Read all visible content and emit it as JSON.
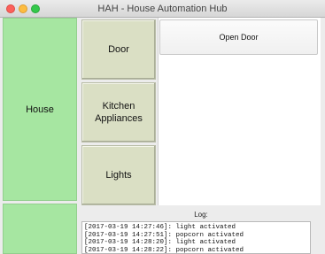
{
  "window": {
    "title": "HAH - House Automation Hub"
  },
  "left": {
    "house_label": "House",
    "second_label": ""
  },
  "devices": {
    "door": "Door",
    "kitchen": "Kitchen Appliances",
    "lights": "Lights"
  },
  "panel": {
    "action": "Open Door"
  },
  "log": {
    "label": "Log:",
    "lines": [
      "[2017-03-19 14:27:46]: light activated",
      "[2017-03-19 14:27:51]: popcorn activated",
      "[2017-03-19 14:28:20]: light activated",
      "[2017-03-19 14:28:22]: popcorn activated"
    ]
  },
  "colors": {
    "room_button": "#a6e6a1",
    "device_button": "#dadfc4"
  }
}
